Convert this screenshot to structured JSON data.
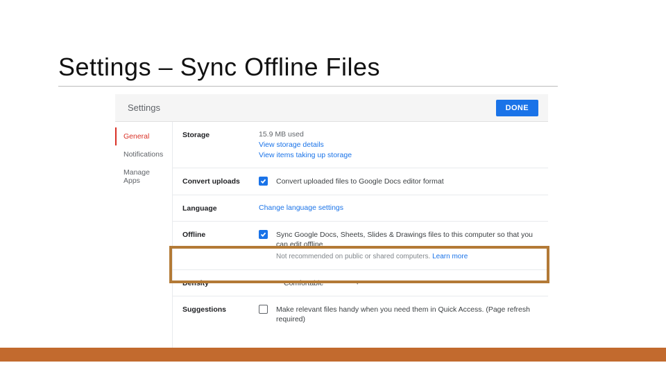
{
  "slide": {
    "title": "Settings – Sync Offline Files"
  },
  "header": {
    "title": "Settings",
    "done_label": "DONE"
  },
  "sidebar": {
    "items": [
      {
        "label": "General",
        "active": true
      },
      {
        "label": "Notifications",
        "active": false
      },
      {
        "label": "Manage Apps",
        "active": false
      }
    ]
  },
  "storage": {
    "label": "Storage",
    "usage": "15.9 MB used",
    "link_details": "View storage details",
    "link_items": "View items taking up storage"
  },
  "convert": {
    "label": "Convert uploads",
    "checked": true,
    "text": "Convert uploaded files to Google Docs editor format"
  },
  "language": {
    "label": "Language",
    "link": "Change language settings"
  },
  "offline": {
    "label": "Offline",
    "checked": true,
    "text": "Sync Google Docs, Sheets, Slides & Drawings files to this computer so that you can edit offline",
    "hint": "Not recommended on public or shared computers.",
    "learn_more": "Learn more"
  },
  "density": {
    "label": "Density",
    "value": "Comfortable"
  },
  "suggestions": {
    "label": "Suggestions",
    "checked": false,
    "text": "Make relevant files handy when you need them in Quick Access. (Page refresh required)"
  }
}
